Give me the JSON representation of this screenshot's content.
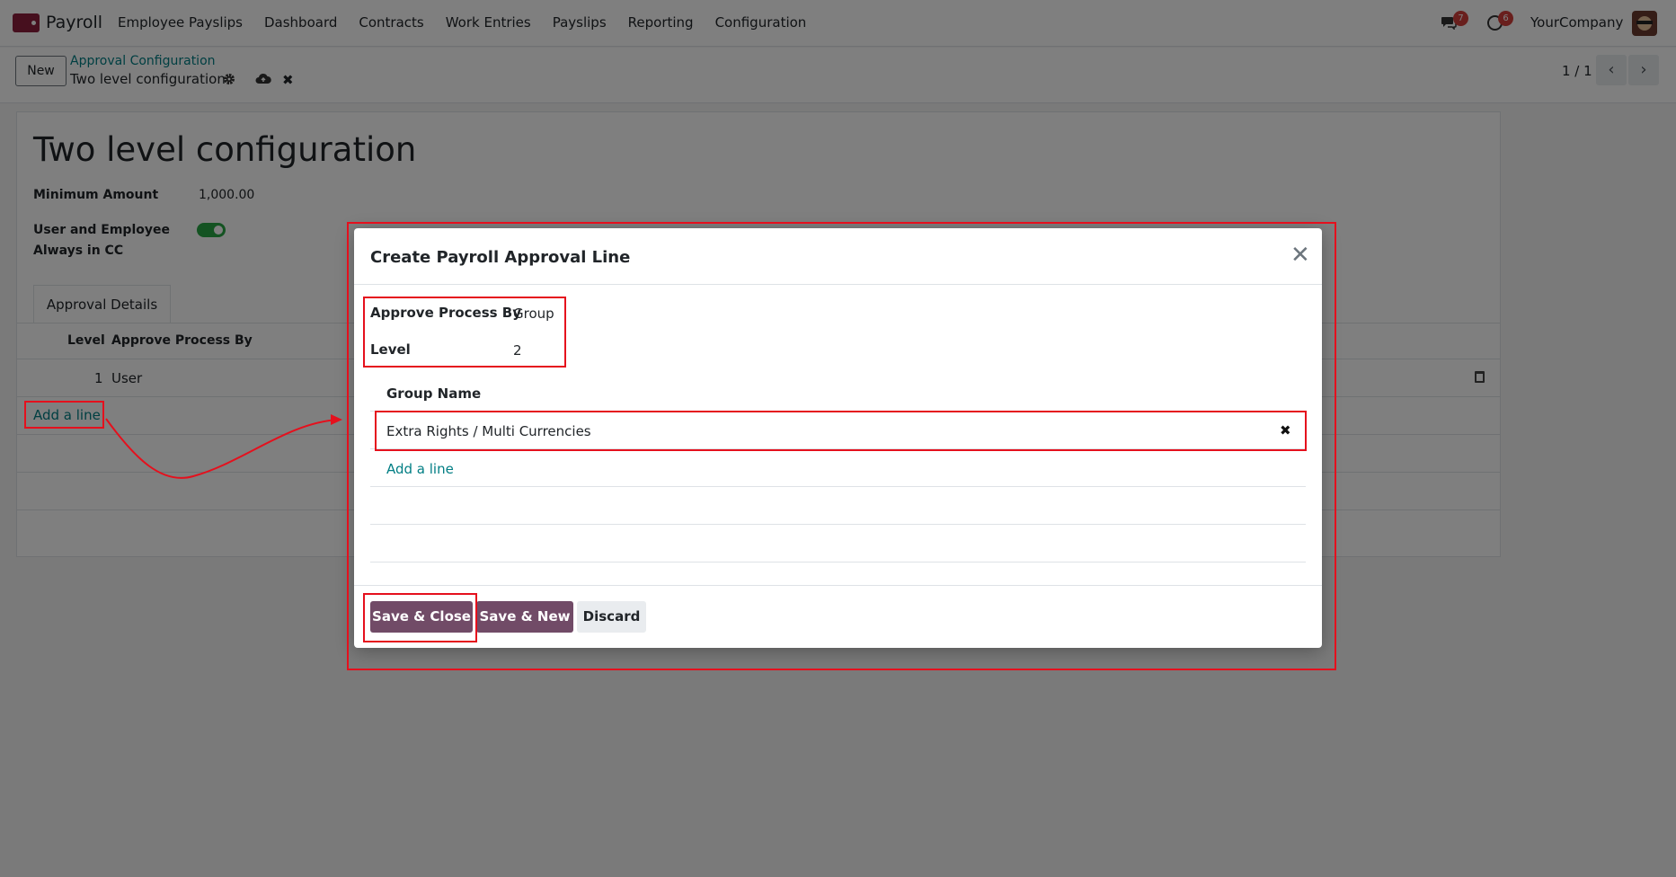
{
  "navbar": {
    "app_name": "Payroll",
    "menu": [
      "Employee Payslips",
      "Dashboard",
      "Contracts",
      "Work Entries",
      "Payslips",
      "Reporting",
      "Configuration"
    ],
    "messages_badge": "7",
    "activities_badge": "6",
    "company": "YourCompany"
  },
  "control_panel": {
    "new_label": "New",
    "breadcrumb": "Approval Configuration",
    "record_name": "Two level configuration",
    "pager": "1 / 1"
  },
  "form": {
    "title": "Two level configuration",
    "minimum_amount_label": "Minimum Amount",
    "minimum_amount_value": "1,000.00",
    "cc_label_1": "User and Employee",
    "cc_label_2": "Always in CC",
    "cc_enabled": true,
    "tab_label": "Approval Details",
    "columns": [
      "Level",
      "Approve Process By"
    ],
    "rows": [
      {
        "level": "1",
        "approve_by": "User"
      }
    ],
    "add_line": "Add a line"
  },
  "dialog": {
    "title": "Create Payroll Approval Line",
    "approve_process_by_label": "Approve Process By",
    "approve_process_by_value": "Group",
    "level_label": "Level",
    "level_value": "2",
    "group_column": "Group Name",
    "group_value": "Extra Rights / Multi Currencies",
    "add_line": "Add a line",
    "save_close": "Save & Close",
    "save_new": "Save & New",
    "discard": "Discard"
  },
  "colors": {
    "primary": "#714b67",
    "link": "#017e84",
    "annotation": "#e5101d",
    "badge": "#d23f3a"
  }
}
